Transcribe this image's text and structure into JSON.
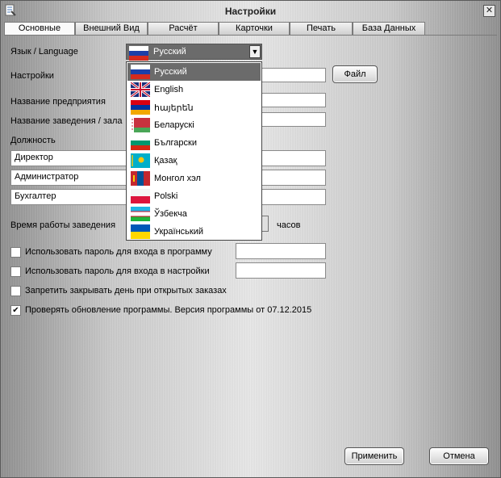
{
  "window": {
    "title": "Настройки"
  },
  "tabs": [
    {
      "label": "Основные",
      "active": true
    },
    {
      "label": "Внешний Вид"
    },
    {
      "label": "Расчёт"
    },
    {
      "label": "Карточки"
    },
    {
      "label": "Печать"
    },
    {
      "label": "База Данных"
    }
  ],
  "form": {
    "language_label": "Язык / Language",
    "settings_label": "Настройки",
    "company_label": "Название предприятия",
    "venue_label": "Название заведения / зала",
    "position_label": "Должность",
    "positions": [
      "Директор",
      "Администратор",
      "Бухгалтер"
    ],
    "hours_label": "Время работы заведения",
    "hours_unit": "часов",
    "file_button": "Файл"
  },
  "language": {
    "selected": "Русский",
    "options": [
      "Русский",
      "English",
      "հայերեն",
      "Беларускі",
      "Български",
      "Қазақ",
      "Монгол хэл",
      "Polski",
      "Ўзбекча",
      "Український"
    ]
  },
  "checkboxes": [
    {
      "label": "Использовать пароль для входа в программу",
      "checked": false
    },
    {
      "label": "Использовать пароль для входа в настройки",
      "checked": false
    },
    {
      "label": "Запретить закрывать день при открытых заказах",
      "checked": false
    },
    {
      "label": "Проверять обновление программы. Версия программы от 07.12.2015",
      "checked": true
    }
  ],
  "checkmark": "✔",
  "close_glyph": "✕",
  "arrow_glyph": "▼",
  "buttons": {
    "apply": "Применить",
    "cancel": "Отмена"
  }
}
